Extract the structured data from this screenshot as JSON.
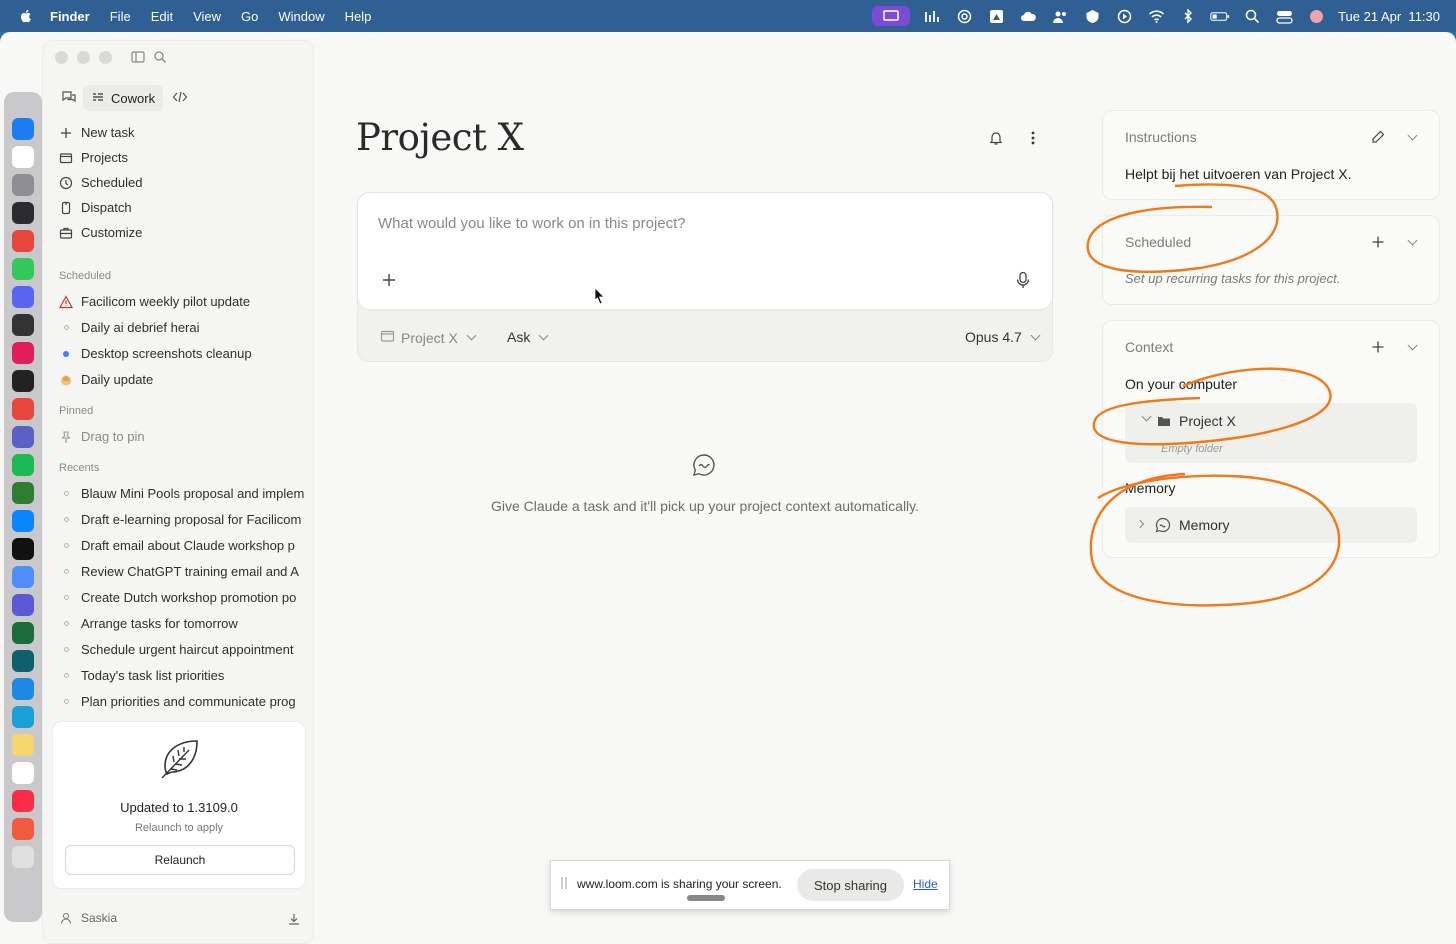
{
  "menubar": {
    "app": "Finder",
    "items": [
      "File",
      "Edit",
      "View",
      "Go",
      "Window",
      "Help"
    ],
    "datetime": "Tue 21 Apr  11:30",
    "icons": [
      "screen-share-icon",
      "bar-chart-icon",
      "spiral-icon",
      "drive-icon",
      "cloud-icon",
      "people-icon",
      "shield-icon",
      "play-icon",
      "wifi-icon",
      "bluetooth-icon",
      "battery-icon",
      "search-icon",
      "control-center-icon",
      "profile-icon"
    ]
  },
  "dock": {
    "colors": [
      "#1e7cf2",
      "#ffffff",
      "#8e8e93",
      "#2c2c2e",
      "#e8453c",
      "#34c759",
      "#5865f2",
      "#333333",
      "#e01e5a",
      "#222222",
      "#e8453c",
      "#5b5fc7",
      "#1db954",
      "#2e7d32",
      "#0a84ff",
      "#111111",
      "#4f8dfd",
      "#5a5ad6",
      "#1c6b3a",
      "#0f5f6f",
      "#1e88e5",
      "#1a9fd6",
      "#f5d76e",
      "#ffffff",
      "#fa2d48",
      "#ef5b3c",
      "#e0e0e0"
    ]
  },
  "sidebar": {
    "mode_label": "Cowork",
    "nav": [
      {
        "label": "New task",
        "icon": "plus-icon"
      },
      {
        "label": "Projects",
        "icon": "folder-icon"
      },
      {
        "label": "Scheduled",
        "icon": "clock-icon"
      },
      {
        "label": "Dispatch",
        "icon": "phone-icon"
      },
      {
        "label": "Customize",
        "icon": "briefcase-icon"
      }
    ],
    "scheduled_heading": "Scheduled",
    "scheduled": [
      {
        "label": "Facilicom weekly pilot update",
        "icon": "warning-icon"
      },
      {
        "label": "Daily ai debrief herai",
        "icon": "dot-icon"
      },
      {
        "label": "Desktop screenshots cleanup",
        "icon": "blue-dot-icon"
      },
      {
        "label": "Daily update",
        "icon": "hand-icon"
      }
    ],
    "pinned_heading": "Pinned",
    "pinned_placeholder": "Drag to pin",
    "recents_heading": "Recents",
    "recents": [
      "Blauw Mini Pools proposal and implem",
      "Draft e-learning proposal for Facilicom",
      "Draft email about Claude workshop p",
      "Review ChatGPT training email and A",
      "Create Dutch workshop promotion po",
      "Arrange tasks for tomorrow",
      "Schedule urgent haircut appointment",
      "Today's task list priorities",
      "Plan priorities and communicate prog"
    ],
    "update": {
      "title": "Updated to 1.3109.0",
      "subtitle": "Relaunch to apply",
      "button": "Relaunch"
    },
    "user": "Saskia"
  },
  "main": {
    "title": "Project X",
    "composer": {
      "placeholder": "What would you like to work on in this project?",
      "project_select": "Project X",
      "mode_select": "Ask",
      "model_select": "Opus 4.7"
    },
    "empty_message": "Give Claude a task and it'll pick up your project context automatically."
  },
  "panels": {
    "instructions": {
      "title": "Instructions",
      "text": "Helpt bij het uitvoeren van Project X."
    },
    "scheduled": {
      "title": "Scheduled",
      "text": "Set up recurring tasks for this project."
    },
    "context": {
      "title": "Context",
      "on_computer_label": "On your computer",
      "folder_name": "Project X",
      "folder_status": "Empty folder",
      "memory_label": "Memory",
      "memory_item": "Memory"
    }
  },
  "loom": {
    "text": "www.loom.com is sharing your screen.",
    "stop": "Stop sharing",
    "hide": "Hide"
  },
  "annotation_color": "#f07a1a"
}
